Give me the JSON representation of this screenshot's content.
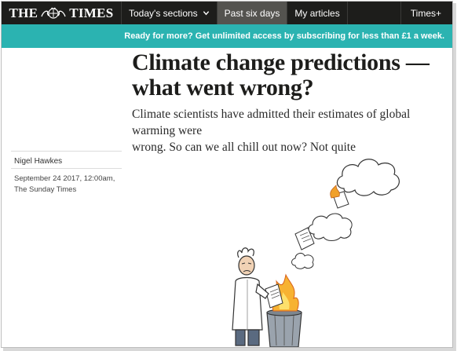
{
  "header": {
    "logo_left": "THE",
    "logo_right": "TIMES",
    "nav": [
      {
        "label": "Today's sections"
      },
      {
        "label": "Past six days"
      },
      {
        "label": "My articles"
      }
    ],
    "plus_label": "Times+"
  },
  "promo": {
    "text": "Ready for more? Get unlimited access by subscribing for less than £1 a week."
  },
  "article": {
    "headline_line1": "Climate change predictions —",
    "headline_line2": "what went wrong?",
    "standfirst_line1": "Climate scientists have admitted their estimates of global warming were",
    "standfirst_line2": "wrong. So can we all chill out now? Not quite",
    "author": "Nigel Hawkes",
    "date": "September 24 2017, 12:00am,",
    "publication": "The Sunday Times"
  },
  "colors": {
    "topbar": "#1d1d1b",
    "active_tab": "#54534f",
    "promo_bg": "#2bb3b1"
  },
  "icons": {
    "crest": "royal-crest-icon",
    "chevron": "chevron-down-icon"
  }
}
